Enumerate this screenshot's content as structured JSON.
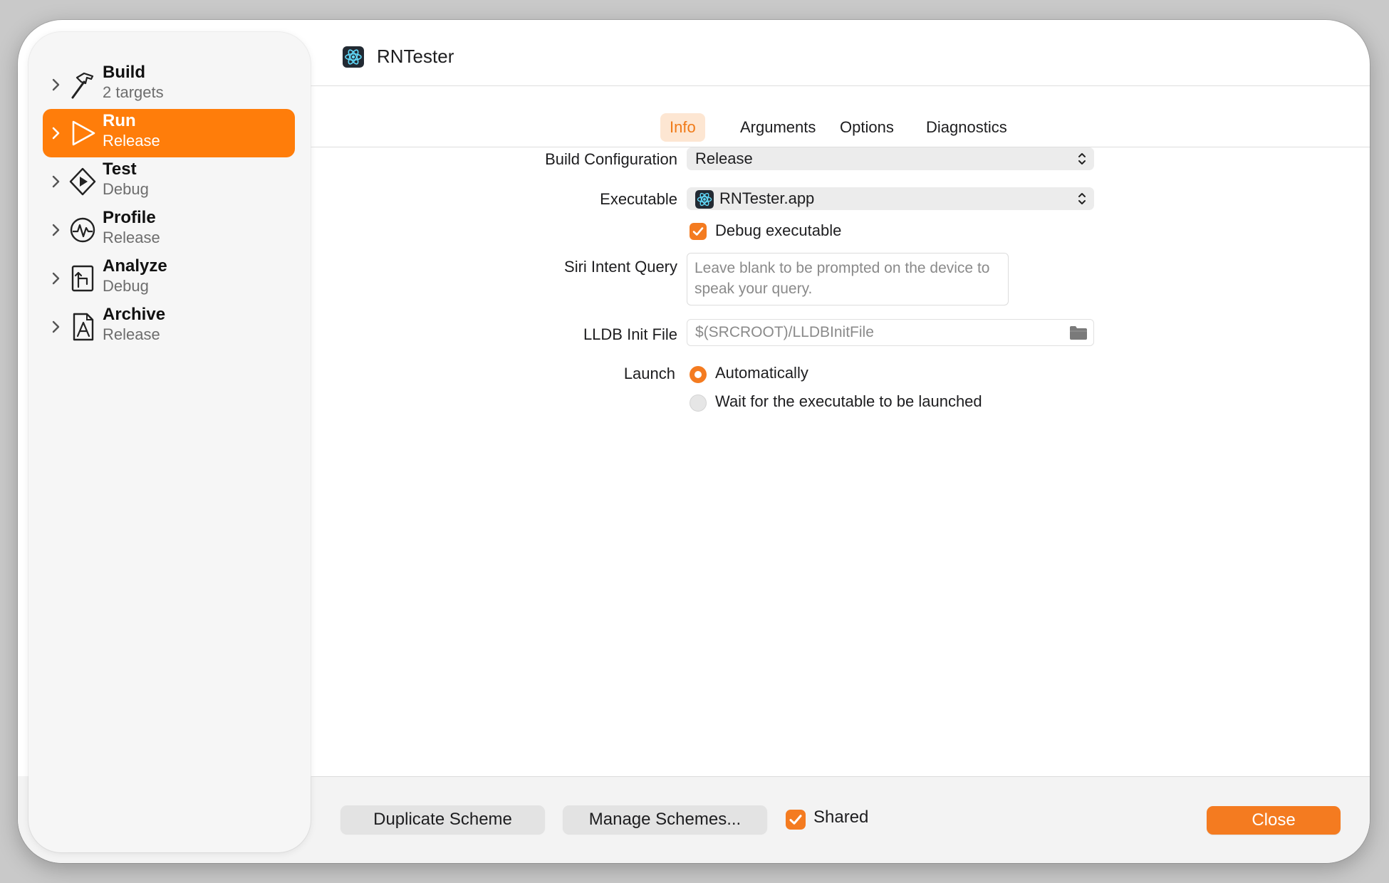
{
  "header": {
    "title": "RNTester",
    "app_icon": "react-atom-icon"
  },
  "sidebar": {
    "items": [
      {
        "title": "Build",
        "subtitle": "2 targets",
        "icon": "hammer-icon",
        "selected": false
      },
      {
        "title": "Run",
        "subtitle": "Release",
        "icon": "play-icon",
        "selected": true
      },
      {
        "title": "Test",
        "subtitle": "Debug",
        "icon": "diamond-play-icon",
        "selected": false
      },
      {
        "title": "Profile",
        "subtitle": "Release",
        "icon": "waveform-icon",
        "selected": false
      },
      {
        "title": "Analyze",
        "subtitle": "Debug",
        "icon": "analyze-icon",
        "selected": false
      },
      {
        "title": "Archive",
        "subtitle": "Release",
        "icon": "archive-icon",
        "selected": false
      }
    ]
  },
  "tabs": [
    {
      "label": "Info",
      "active": true
    },
    {
      "label": "Arguments",
      "active": false
    },
    {
      "label": "Options",
      "active": false
    },
    {
      "label": "Diagnostics",
      "active": false
    }
  ],
  "form": {
    "build_configuration": {
      "label": "Build Configuration",
      "value": "Release"
    },
    "executable": {
      "label": "Executable",
      "value": "RNTester.app"
    },
    "debug_executable": {
      "label": "Debug executable",
      "checked": true
    },
    "siri_intent_query": {
      "label": "Siri Intent Query",
      "placeholder": "Leave blank to be prompted on the device to speak your query."
    },
    "lldb_init_file": {
      "label": "LLDB Init File",
      "placeholder": "$(SRCROOT)/LLDBInitFile"
    },
    "launch": {
      "label": "Launch",
      "options": [
        {
          "label": "Automatically",
          "selected": true
        },
        {
          "label": "Wait for the executable to be launched",
          "selected": false
        }
      ]
    }
  },
  "footer": {
    "duplicate_label": "Duplicate Scheme",
    "manage_label": "Manage Schemes...",
    "shared_label": "Shared",
    "shared_checked": true,
    "close_label": "Close"
  },
  "colors": {
    "accent": "#f47b20",
    "selected_row": "#ff7d0a",
    "active_tab_bg": "#fde6d2"
  }
}
